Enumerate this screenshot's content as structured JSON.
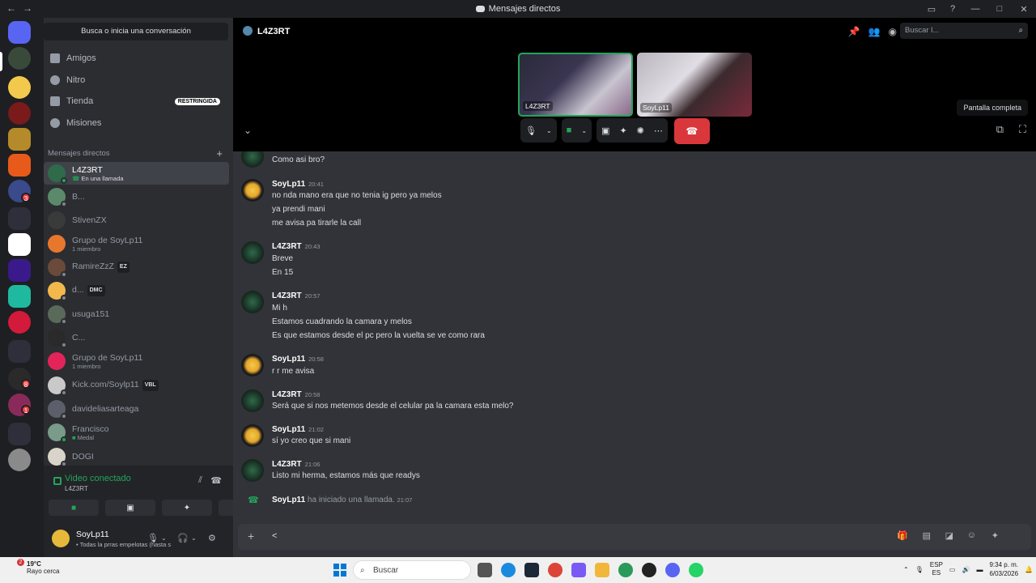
{
  "window": {
    "title": "Mensajes directos",
    "back": "←",
    "forward": "→"
  },
  "dm_search": "Busca o inicia una conversación",
  "nav": [
    {
      "label": "Amigos"
    },
    {
      "label": "Nitro"
    },
    {
      "label": "Tienda",
      "badge": "RESTRINGIDA"
    },
    {
      "label": "Misiones"
    }
  ],
  "dm_header": "Mensajes directos",
  "dm_list": [
    {
      "name": "L4Z3RT",
      "sub": "En una llamada",
      "active": true
    },
    {
      "name": "B...",
      "sub": ""
    },
    {
      "name": "StivenZX",
      "sub": ""
    },
    {
      "name": "Grupo de SoyLp11",
      "sub": "1 miembro"
    },
    {
      "name": "RamireZzZ",
      "sub": "",
      "tag": "EZ"
    },
    {
      "name": "d...",
      "sub": "",
      "tag": "DMC"
    },
    {
      "name": "usuga151",
      "sub": ""
    },
    {
      "name": "C...",
      "sub": ""
    },
    {
      "name": "Grupo de SoyLp11",
      "sub": "1 miembro"
    },
    {
      "name": "Kick.com/Soylp11",
      "sub": "",
      "tag": "VBL"
    },
    {
      "name": "davideliasarteaga",
      "sub": ""
    },
    {
      "name": "Francisco",
      "sub": "Medal"
    },
    {
      "name": "DOGI",
      "sub": ""
    }
  ],
  "voice": {
    "status": "Video conectado",
    "channel": "L4Z3RT"
  },
  "user": {
    "name": "SoyLp11",
    "status": "• Todas la prras empelotas (hasta s"
  },
  "call": {
    "header": "L4Z3RT",
    "search_placeholder": "Buscar l...",
    "tiles": [
      "L4Z3RT",
      "SoyLp11"
    ],
    "tooltip": "Pantalla completa"
  },
  "messages": [
    {
      "type": "cont",
      "text": "Como asi bro?"
    },
    {
      "type": "group",
      "author": "SoyLp11",
      "time": "20:41",
      "lines": [
        "no nda mano era que no tenia ig pero ya melos",
        "ya prendi mani",
        "me avisa pa tirarle la call"
      ]
    },
    {
      "type": "group",
      "author": "L4Z3RT",
      "time": "20:43",
      "lines": [
        "Breve",
        "En 15"
      ]
    },
    {
      "type": "group",
      "author": "L4Z3RT",
      "time": "20:57",
      "lines": [
        "Mi h",
        "Estamos cuadrando la camara y melos",
        "Es que estamos desde el pc pero la vuelta se ve como rara"
      ]
    },
    {
      "type": "group",
      "author": "SoyLp11",
      "time": "20:58",
      "lines": [
        "r r me avisa"
      ]
    },
    {
      "type": "group",
      "author": "L4Z3RT",
      "time": "20:58",
      "lines": [
        "Será que si nos metemos desde el celular pa la camara esta melo?"
      ]
    },
    {
      "type": "group",
      "author": "SoyLp11",
      "time": "21:02",
      "lines": [
        "sí yo creo que si mani"
      ]
    },
    {
      "type": "group",
      "author": "L4Z3RT",
      "time": "21:06",
      "lines": [
        "Listo mi herma, estamos más que readys"
      ]
    }
  ],
  "system_msg": {
    "author": "SoyLp11",
    "text": "ha iniciado una llamada.",
    "time": "21:07"
  },
  "composer_text": "<",
  "taskbar": {
    "weather_temp": "19°C",
    "weather_desc": "Rayo cerca",
    "weather_badge": "2",
    "search": "Buscar",
    "lang1": "ESP",
    "lang2": "ES",
    "time": "9:34 p. m.",
    "date": "6/03/2026"
  },
  "rail_badges": [
    "3",
    "8",
    "1"
  ],
  "colors": {
    "online": "#23a55a",
    "danger": "#da373c",
    "blurple": "#5865f2"
  }
}
